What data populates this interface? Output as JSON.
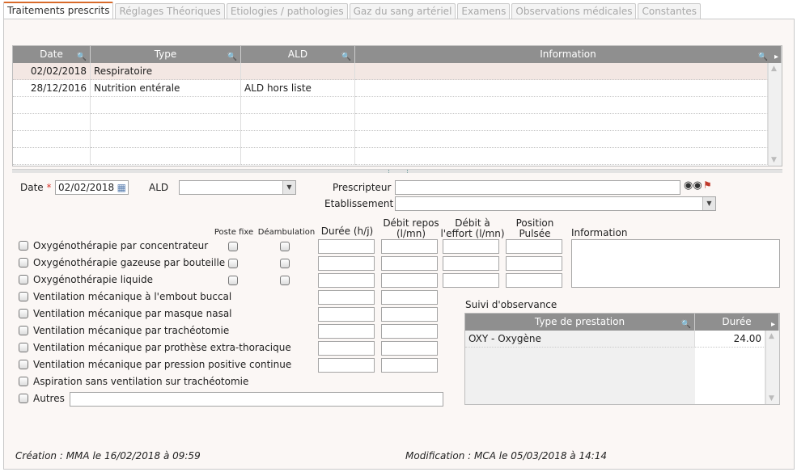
{
  "tabs": [
    "Traitements prescrits",
    "Réglages Théoriques",
    "Etiologies / pathologies",
    "Gaz du sang artériel",
    "Examens",
    "Observations médicales",
    "Constantes"
  ],
  "grid": {
    "columns": [
      "Date",
      "Type",
      "ALD",
      "Information"
    ],
    "rows": [
      {
        "date": "02/02/2018",
        "type": "Respiratoire",
        "ald": "",
        "info": ""
      },
      {
        "date": "28/12/2016",
        "type": "Nutrition entérale",
        "ald": "ALD hors liste",
        "info": ""
      }
    ]
  },
  "form": {
    "date_label": "Date",
    "required_mark": "*",
    "date_value": "02/02/2018",
    "ald_label": "ALD",
    "prescripteur_label": "Prescripteur",
    "etablissement_label": "Etablissement"
  },
  "headers": {
    "poste_fixe": "Poste fixe",
    "deambulation": "Déambulation",
    "duree": "Durée (h/j)",
    "debit_repos_1": "Débit repos",
    "debit_repos_2": "(l/mn)",
    "debit_effort_1": "Débit à",
    "debit_effort_2": "l'effort (l/mn)",
    "position_1": "Position",
    "position_2": "Pulsée",
    "information": "Information"
  },
  "therapies": [
    "Oxygénothérapie par concentrateur",
    "Oxygénothérapie gazeuse par bouteille",
    "Oxygénothérapie liquide",
    "Ventilation mécanique à l'embout buccal",
    "Ventilation mécanique par masque nasal",
    "Ventilation mécanique par trachéotomie",
    "Ventilation mécanique par prothèse extra-thoracique",
    "Ventilation mécanique par pression positive continue",
    "Aspiration sans ventilation sur trachéotomie",
    "Autres"
  ],
  "suivi": {
    "title": "Suivi d'observance",
    "col_type": "Type de prestation",
    "col_duree": "Durée",
    "rows": [
      {
        "type": "OXY - Oxygène",
        "duree": "24.00"
      }
    ]
  },
  "footer": {
    "creation": "Création : MMA le 16/02/2018 à 09:59",
    "modification": "Modification : MCA le 05/03/2018 à 14:14"
  },
  "colors": {
    "accent": "#d86a2a",
    "header_gray": "#8f8f8f",
    "selected_row": "#f3e7e3",
    "required": "#d9342b"
  },
  "icons": [
    "magnifier-icon",
    "calendar-icon",
    "binoculars-icon",
    "flag-icon",
    "dropdown-arrow-icon",
    "scroll-arrow-icon"
  ]
}
